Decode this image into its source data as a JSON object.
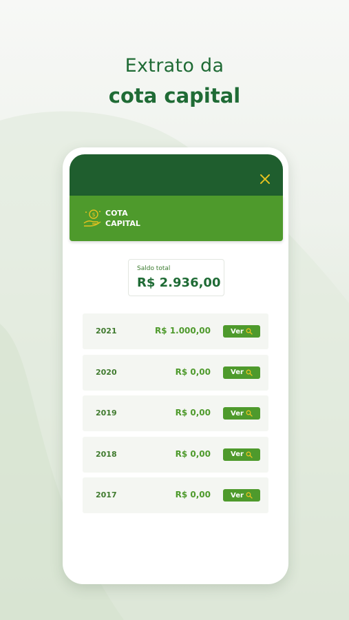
{
  "headline": {
    "line1": "Extrato da",
    "line2": "cota capital"
  },
  "header": {
    "close_icon": "close-icon"
  },
  "section": {
    "title_line1": "COTA",
    "title_line2": "CAPITAL",
    "icon": "coins-hand-icon"
  },
  "saldo": {
    "label": "Saldo total",
    "value": "R$ 2.936,00"
  },
  "years": [
    {
      "year": "2021",
      "amount": "R$ 1.000,00",
      "button_label": "Ver"
    },
    {
      "year": "2020",
      "amount": "R$ 0,00",
      "button_label": "Ver"
    },
    {
      "year": "2019",
      "amount": "R$ 0,00",
      "button_label": "Ver"
    },
    {
      "year": "2018",
      "amount": "R$ 0,00",
      "button_label": "Ver"
    },
    {
      "year": "2017",
      "amount": "R$ 0,00",
      "button_label": "Ver"
    }
  ],
  "colors": {
    "dark_green": "#1f5e2e",
    "accent_green": "#4e9a2c",
    "close_yellow": "#e6c220",
    "headline_green": "#1f6b35"
  }
}
